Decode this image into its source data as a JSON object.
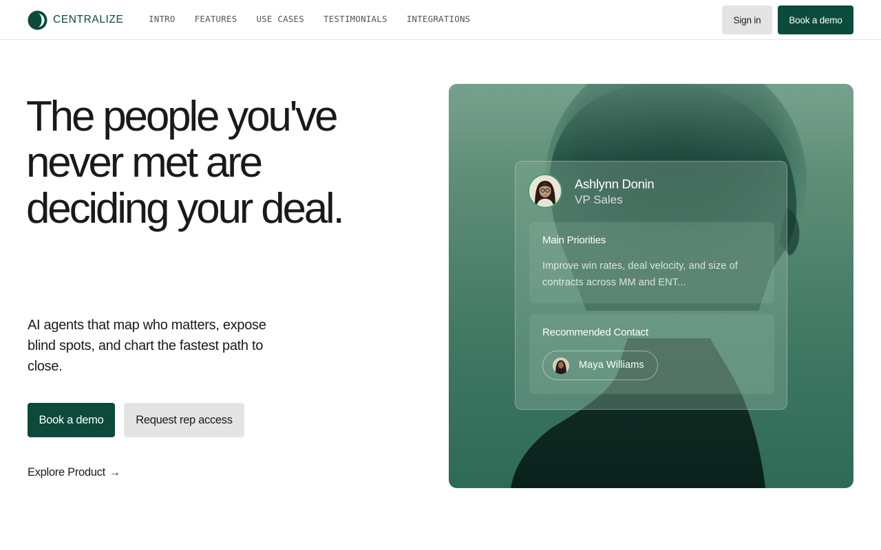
{
  "brand": {
    "name": "CENTRALIZE",
    "color": "#0c4a3c"
  },
  "nav": {
    "items": [
      {
        "label": "INTRO"
      },
      {
        "label": "FEATURES"
      },
      {
        "label": "USE CASES"
      },
      {
        "label": "TESTIMONIALS"
      },
      {
        "label": "INTEGRATIONS"
      }
    ]
  },
  "header": {
    "signin_label": "Sign in",
    "demo_label": "Book a demo"
  },
  "hero": {
    "headline_lines": [
      "The people you've",
      "never met are",
      "deciding your deal."
    ],
    "subtext": "AI agents that map who matters, expose blind spots, and chart the fastest path to close.",
    "primary_cta": "Book a demo",
    "secondary_cta": "Request rep access",
    "explore_link": "Explore Product",
    "explore_arrow": "→"
  },
  "profile_card": {
    "name": "Ashlynn Donin",
    "role": "VP Sales",
    "priorities_title": "Main Priorities",
    "priorities_text": "Improve win rates, deal velocity, and size of contracts across MM and ENT...",
    "recommended_title": "Recommended Contact",
    "recommended_contact": "Maya Williams"
  }
}
